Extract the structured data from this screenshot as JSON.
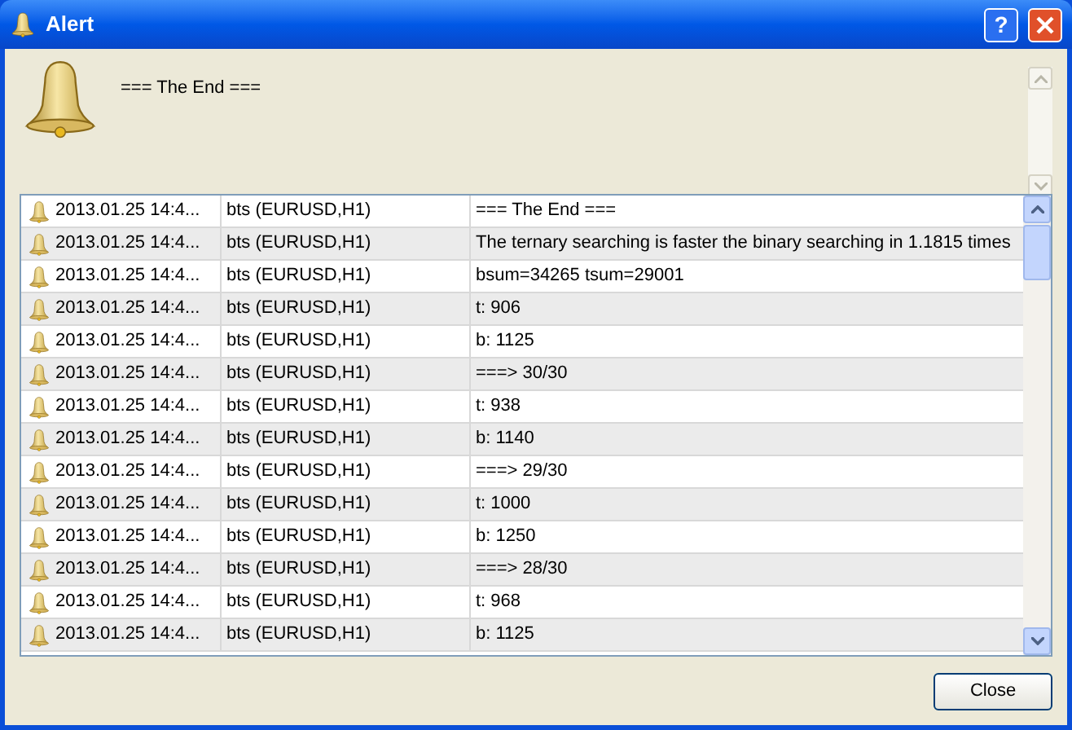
{
  "window": {
    "title": "Alert"
  },
  "message": "=== The End ===",
  "rows": [
    {
      "time": "2013.01.25 14:4...",
      "source": "bts (EURUSD,H1)",
      "text": "=== The End ==="
    },
    {
      "time": "2013.01.25 14:4...",
      "source": "bts (EURUSD,H1)",
      "text": "The ternary searching is faster the binary searching in 1.1815 times"
    },
    {
      "time": "2013.01.25 14:4...",
      "source": "bts (EURUSD,H1)",
      "text": "bsum=34265 tsum=29001"
    },
    {
      "time": "2013.01.25 14:4...",
      "source": "bts (EURUSD,H1)",
      "text": "t: 906"
    },
    {
      "time": "2013.01.25 14:4...",
      "source": "bts (EURUSD,H1)",
      "text": "b: 1125"
    },
    {
      "time": "2013.01.25 14:4...",
      "source": "bts (EURUSD,H1)",
      "text": "===> 30/30"
    },
    {
      "time": "2013.01.25 14:4...",
      "source": "bts (EURUSD,H1)",
      "text": "t: 938"
    },
    {
      "time": "2013.01.25 14:4...",
      "source": "bts (EURUSD,H1)",
      "text": "b: 1140"
    },
    {
      "time": "2013.01.25 14:4...",
      "source": "bts (EURUSD,H1)",
      "text": "===> 29/30"
    },
    {
      "time": "2013.01.25 14:4...",
      "source": "bts (EURUSD,H1)",
      "text": "t: 1000"
    },
    {
      "time": "2013.01.25 14:4...",
      "source": "bts (EURUSD,H1)",
      "text": "b: 1250"
    },
    {
      "time": "2013.01.25 14:4...",
      "source": "bts (EURUSD,H1)",
      "text": "===> 28/30"
    },
    {
      "time": "2013.01.25 14:4...",
      "source": "bts (EURUSD,H1)",
      "text": "t: 968"
    },
    {
      "time": "2013.01.25 14:4...",
      "source": "bts (EURUSD,H1)",
      "text": "b: 1125"
    }
  ],
  "buttons": {
    "help": "?",
    "close": "Close"
  }
}
